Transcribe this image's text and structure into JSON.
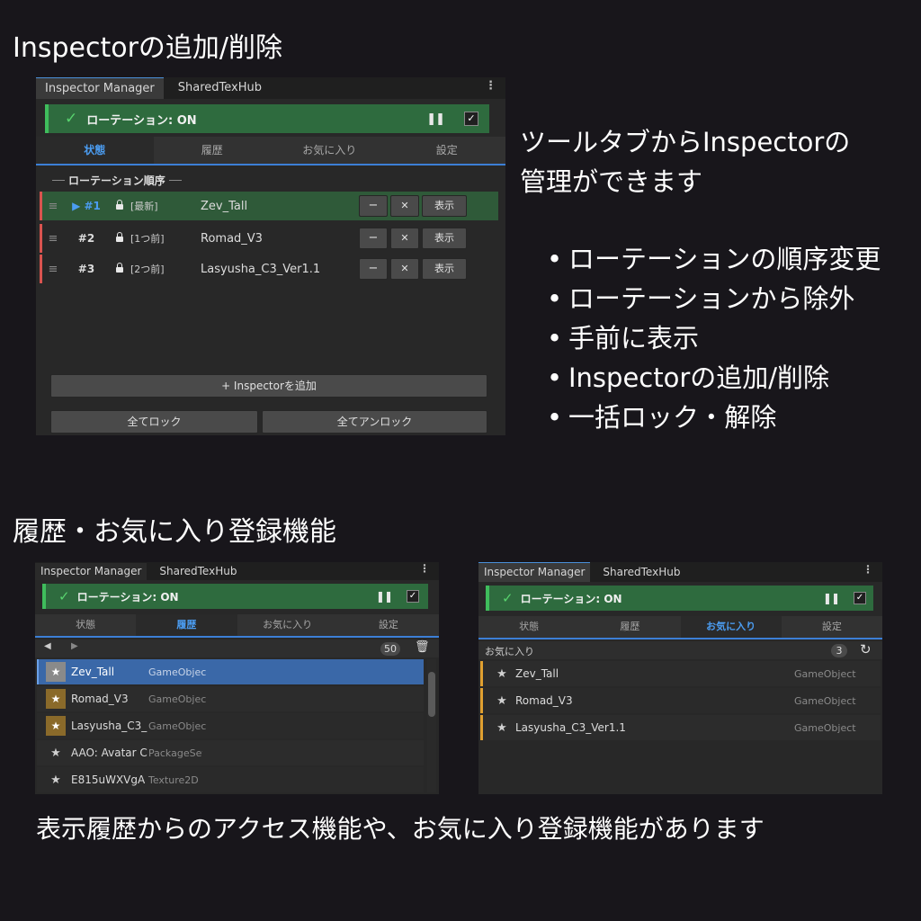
{
  "section1": {
    "heading": "Inspectorの追加/削除",
    "desc_line1": "ツールタブからInspectorの",
    "desc_line2": "管理ができます",
    "bullets": [
      "ローテーションの順序変更",
      "ローテーションから除外",
      "手前に表示",
      "Inspectorの追加/削除",
      "一括ロック・解除"
    ]
  },
  "panel_main": {
    "window_tabs": [
      "Inspector Manager",
      "SharedTexHub"
    ],
    "rotation_label": "ローテーション: ON",
    "subtabs": [
      "状態",
      "履歴",
      "お気に入り",
      "設定"
    ],
    "active_subtab": "状態",
    "section_label": "ローテーション順序",
    "rows": [
      {
        "handle": "≡",
        "index": "▶ #1",
        "tag": "[最新]",
        "name": "Zev_Tall",
        "btn_minus": "−",
        "btn_close": "✕",
        "btn_show": "表示",
        "accent": "#d9534f"
      },
      {
        "handle": "≡",
        "index": "#2",
        "tag": "[1つ前]",
        "name": "Romad_V3",
        "btn_minus": "−",
        "btn_close": "✕",
        "btn_show": "表示",
        "accent": "#d9534f"
      },
      {
        "handle": "≡",
        "index": "#3",
        "tag": "[2つ前]",
        "name": "Lasyusha_C3_Ver1.1",
        "btn_minus": "−",
        "btn_close": "✕",
        "btn_show": "表示",
        "accent": "#d9534f"
      }
    ],
    "add_button": "+ Inspectorを追加",
    "lock_all": "全てロック",
    "unlock_all": "全てアンロック"
  },
  "section2": {
    "heading": "履歴・お気に入り登録機能",
    "caption": "表示履歴からのアクセス機能や、お気に入り登録機能があります"
  },
  "panel_history": {
    "window_tabs": [
      "Inspector Manager",
      "SharedTexHub"
    ],
    "rotation_label": "ローテーション: ON",
    "subtabs": [
      "状態",
      "履歴",
      "お気に入り",
      "設定"
    ],
    "active_subtab": "履歴",
    "count": "50",
    "items": [
      {
        "name": "Zev_Tall",
        "type": "GameObjec",
        "favorite": true
      },
      {
        "name": "Romad_V3",
        "type": "GameObjec",
        "favorite": true
      },
      {
        "name": "Lasyusha_C3_",
        "type": "GameObjec",
        "favorite": true
      },
      {
        "name": "AAO: Avatar C",
        "type": "PackageSet",
        "favorite": false
      },
      {
        "name": "E815uWXVgA",
        "type": "Texture2D",
        "favorite": false
      }
    ]
  },
  "panel_fav": {
    "window_tabs": [
      "Inspector Manager",
      "SharedTexHub"
    ],
    "rotation_label": "ローテーション: ON",
    "subtabs": [
      "状態",
      "履歴",
      "お気に入り",
      "設定"
    ],
    "active_subtab": "お気に入り",
    "list_label": "お気に入り",
    "count": "3",
    "items": [
      {
        "name": "Zev_Tall",
        "type": "GameObject"
      },
      {
        "name": "Romad_V3",
        "type": "GameObject"
      },
      {
        "name": "Lasyusha_C3_Ver1.1",
        "type": "GameObject"
      }
    ]
  },
  "colors": {
    "bg": "#18161b",
    "rotation_green": "#2e6b3e",
    "active_blue": "#4b9cf0",
    "selection": "#3a68a8",
    "fav_accent": "#e0a030"
  }
}
